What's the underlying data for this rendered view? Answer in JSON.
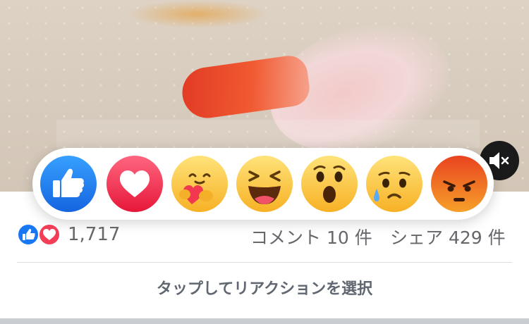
{
  "video": {
    "ghost_caption": ""
  },
  "mute_button": {
    "icon": "speaker-muted-icon"
  },
  "reactions": [
    {
      "name": "like",
      "icon": "like-reaction-icon",
      "color": "#1877f2"
    },
    {
      "name": "love",
      "icon": "love-reaction-icon",
      "color": "#f33e58"
    },
    {
      "name": "care",
      "icon": "care-reaction-icon",
      "color": "#f7b125"
    },
    {
      "name": "haha",
      "icon": "haha-reaction-icon",
      "color": "#f7b125"
    },
    {
      "name": "wow",
      "icon": "wow-reaction-icon",
      "color": "#f7b125"
    },
    {
      "name": "sad",
      "icon": "sad-reaction-icon",
      "color": "#f7b125"
    },
    {
      "name": "angry",
      "icon": "angry-reaction-icon",
      "color": "#e9710f"
    }
  ],
  "stats": {
    "reaction_count": "1,717",
    "comments": "コメント 10 件",
    "shares": "シェア 429 件"
  },
  "hint": "タップしてリアクションを選択"
}
